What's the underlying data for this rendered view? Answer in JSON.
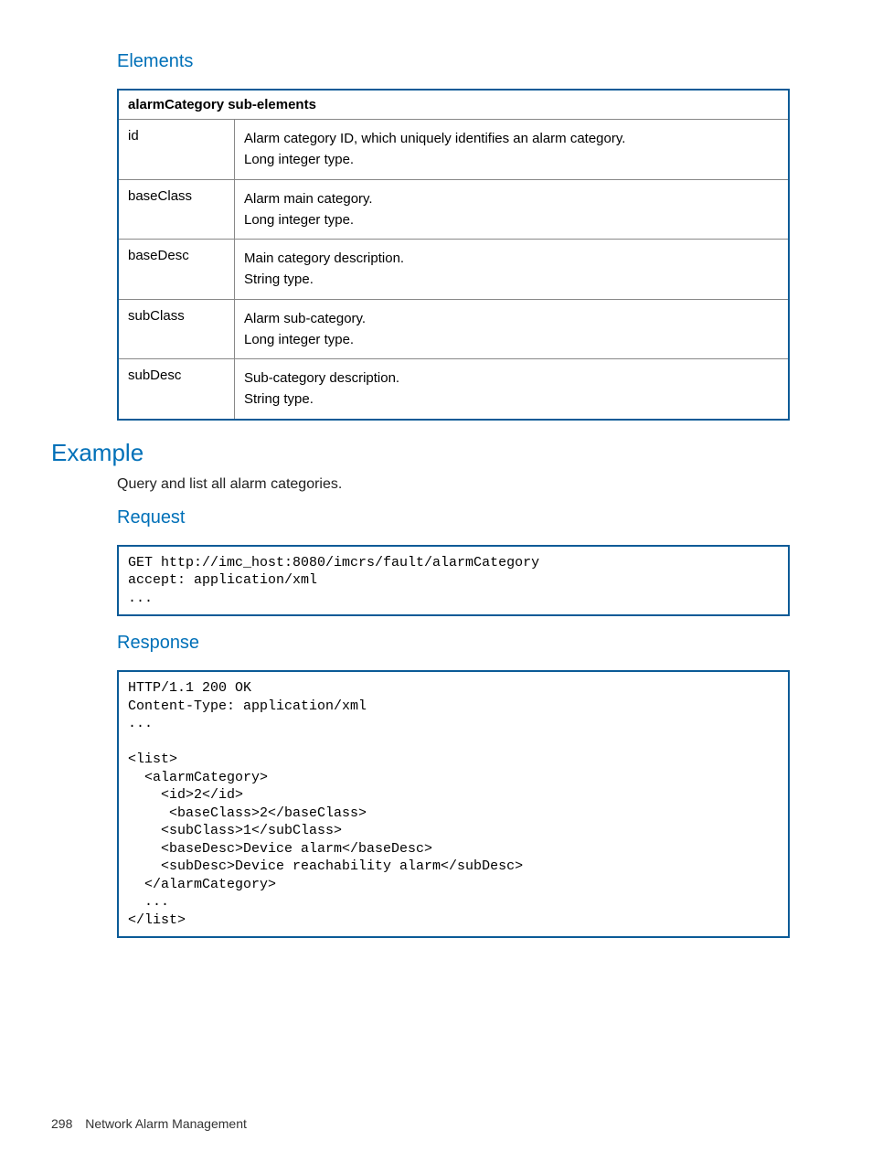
{
  "headings": {
    "elements": "Elements",
    "example": "Example",
    "request": "Request",
    "response": "Response"
  },
  "table": {
    "header": "alarmCategory sub-elements",
    "rows": [
      {
        "key": "id",
        "desc1": "Alarm category ID, which uniquely identifies an alarm category.",
        "desc2": "Long integer type."
      },
      {
        "key": "baseClass",
        "desc1": "Alarm main category.",
        "desc2": "Long integer type."
      },
      {
        "key": "baseDesc",
        "desc1": "Main category description.",
        "desc2": "String type."
      },
      {
        "key": "subClass",
        "desc1": "Alarm sub-category.",
        "desc2": "Long integer type."
      },
      {
        "key": "subDesc",
        "desc1": "Sub-category description.",
        "desc2": "String type."
      }
    ]
  },
  "example_intro": "Query and list all alarm categories.",
  "request_code": "GET http://imc_host:8080/imcrs/fault/alarmCategory\naccept: application/xml\n...",
  "response_code": "HTTP/1.1 200 OK\nContent-Type: application/xml\n...\n\n<list>\n  <alarmCategory>\n    <id>2</id>\n     <baseClass>2</baseClass>\n    <subClass>1</subClass>\n    <baseDesc>Device alarm</baseDesc>\n    <subDesc>Device reachability alarm</subDesc>\n  </alarmCategory>\n  ...\n</list>",
  "footer": {
    "page_number": "298",
    "section": "Network Alarm Management"
  }
}
